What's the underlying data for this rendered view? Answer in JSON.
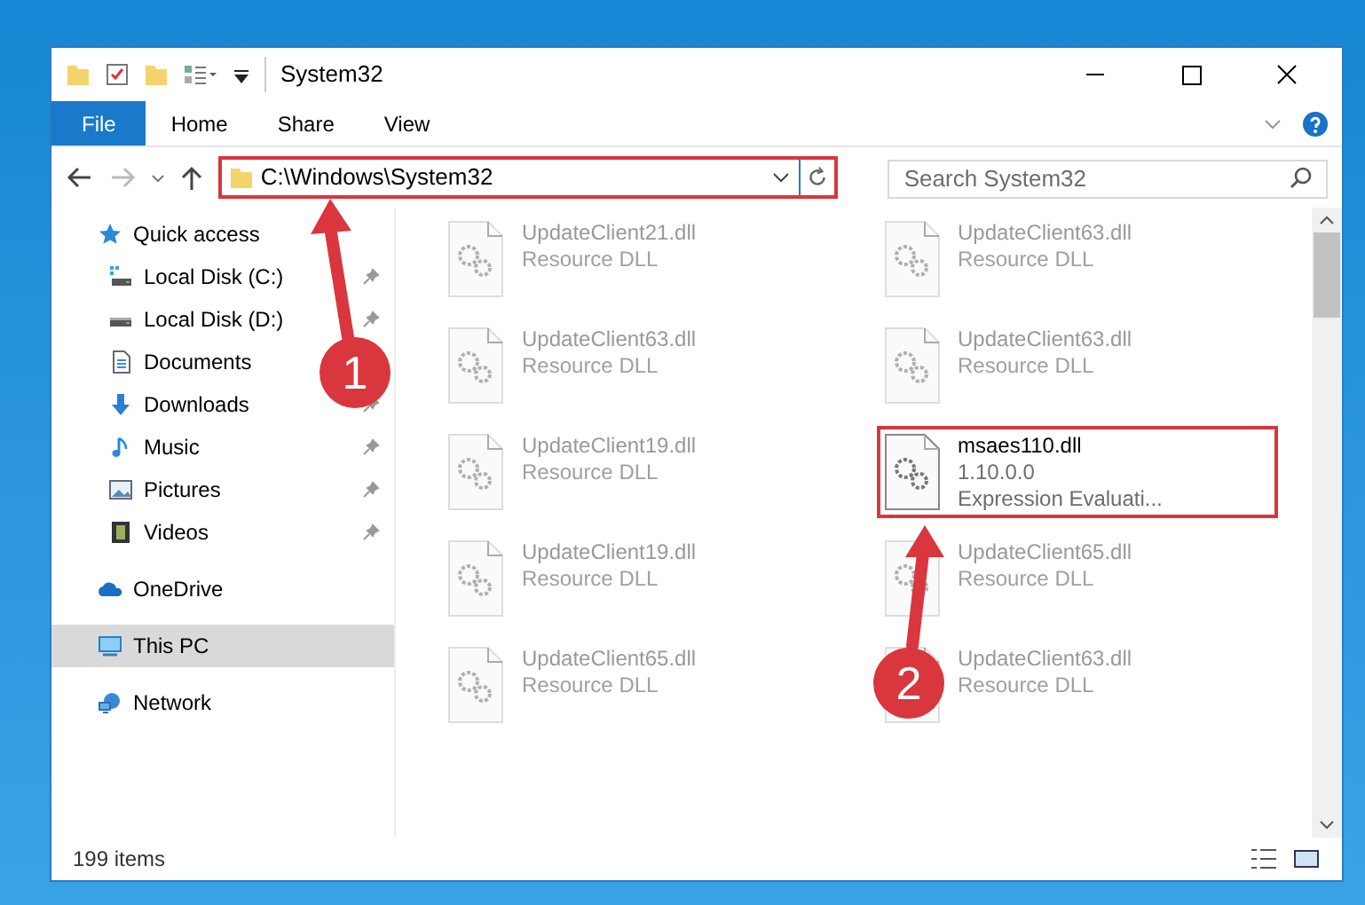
{
  "window": {
    "title": "System32"
  },
  "ribbon_tabs": [
    {
      "label": "File",
      "selected": true
    },
    {
      "label": "Home",
      "selected": false
    },
    {
      "label": "Share",
      "selected": false
    },
    {
      "label": "View",
      "selected": false
    }
  ],
  "address": {
    "path": "C:\\Windows\\System32",
    "highlighted": true
  },
  "search": {
    "placeholder": "Search System32"
  },
  "nav": [
    {
      "label": "Quick access",
      "kind": "star",
      "selected": false,
      "children": [
        {
          "label": "Local Disk (C:)",
          "kind": "drive-c",
          "pinned": true,
          "selected": false
        },
        {
          "label": "Local Disk (D:)",
          "kind": "drive",
          "pinned": true,
          "selected": false
        },
        {
          "label": "Documents",
          "kind": "documents",
          "selected": false
        },
        {
          "label": "Downloads",
          "kind": "downloads",
          "pinned": true,
          "selected": false
        },
        {
          "label": "Music",
          "kind": "music",
          "pinned": true,
          "selected": false
        },
        {
          "label": "Pictures",
          "kind": "pictures",
          "pinned": true,
          "selected": false
        },
        {
          "label": "Videos",
          "kind": "videos",
          "pinned": true,
          "selected": false
        }
      ]
    },
    {
      "label": "OneDrive",
      "kind": "cloud",
      "selected": false
    },
    {
      "label": "This PC",
      "kind": "pc",
      "selected": true
    },
    {
      "label": "Network",
      "kind": "network",
      "selected": false
    }
  ],
  "files": [
    {
      "name": "UpdateClient21.dll",
      "lines": [
        "Resource DLL"
      ],
      "blurred": true,
      "highlighted": false
    },
    {
      "name": "UpdateClient63.dll",
      "lines": [
        "Resource DLL"
      ],
      "blurred": true,
      "highlighted": false
    },
    {
      "name": "UpdateClient63.dll",
      "lines": [
        "Resource DLL"
      ],
      "blurred": true,
      "highlighted": false
    },
    {
      "name": "UpdateClient63.dll",
      "lines": [
        "Resource DLL"
      ],
      "blurred": true,
      "highlighted": false
    },
    {
      "name": "UpdateClient19.dll",
      "lines": [
        "Resource DLL"
      ],
      "blurred": true,
      "highlighted": false
    },
    {
      "name": "msaes110.dll",
      "lines": [
        "1.10.0.0",
        "Expression Evaluati..."
      ],
      "blurred": false,
      "highlighted": true
    },
    {
      "name": "UpdateClient19.dll",
      "lines": [
        "Resource DLL"
      ],
      "blurred": true,
      "highlighted": false
    },
    {
      "name": "UpdateClient65.dll",
      "lines": [
        "Resource DLL"
      ],
      "blurred": true,
      "highlighted": false
    },
    {
      "name": "UpdateClient65.dll",
      "lines": [
        "Resource DLL"
      ],
      "blurred": true,
      "highlighted": false
    },
    {
      "name": "UpdateClient63.dll",
      "lines": [
        "Resource DLL"
      ],
      "blurred": true,
      "highlighted": false
    }
  ],
  "status_bar": {
    "items": "199 items"
  },
  "callouts": [
    {
      "number": "1"
    },
    {
      "number": "2"
    }
  ]
}
